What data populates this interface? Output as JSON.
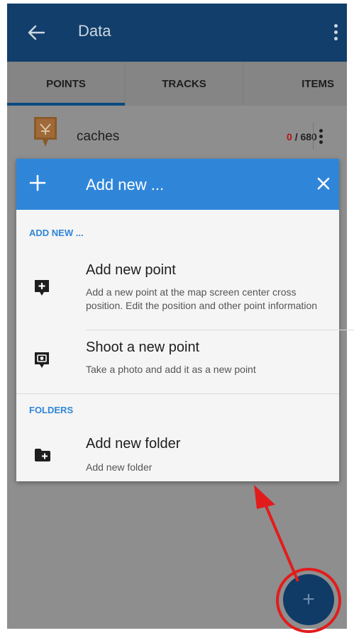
{
  "appbar": {
    "title": "Data"
  },
  "tabs": [
    {
      "label": "POINTS",
      "active": true
    },
    {
      "label": "TRACKS",
      "active": false
    },
    {
      "label": "ITEMS",
      "active": false
    }
  ],
  "list": {
    "items": [
      {
        "name": "caches",
        "count_visible": "0",
        "count_total": "/ 680"
      }
    ]
  },
  "dialog": {
    "title": "Add new ...",
    "sections": [
      {
        "label": "ADD NEW ...",
        "items": [
          {
            "title": "Add new point",
            "description": "Add a new point at the map screen center cross position. Edit the position and other point information",
            "icon": "add-point-icon"
          },
          {
            "title": "Shoot a new point",
            "description": "Take a photo and add it as a new point",
            "icon": "camera-point-icon"
          }
        ]
      },
      {
        "label": "FOLDERS",
        "items": [
          {
            "title": "Add new folder",
            "description": "Add new folder",
            "icon": "add-folder-icon"
          }
        ]
      }
    ]
  },
  "fab": {
    "label": "+"
  },
  "colors": {
    "appbar": "#113e6b",
    "dialog_header": "#2f86d9",
    "section_label": "#2f86d9",
    "annotation_red": "#e21c1c",
    "count_red": "#b41414"
  }
}
